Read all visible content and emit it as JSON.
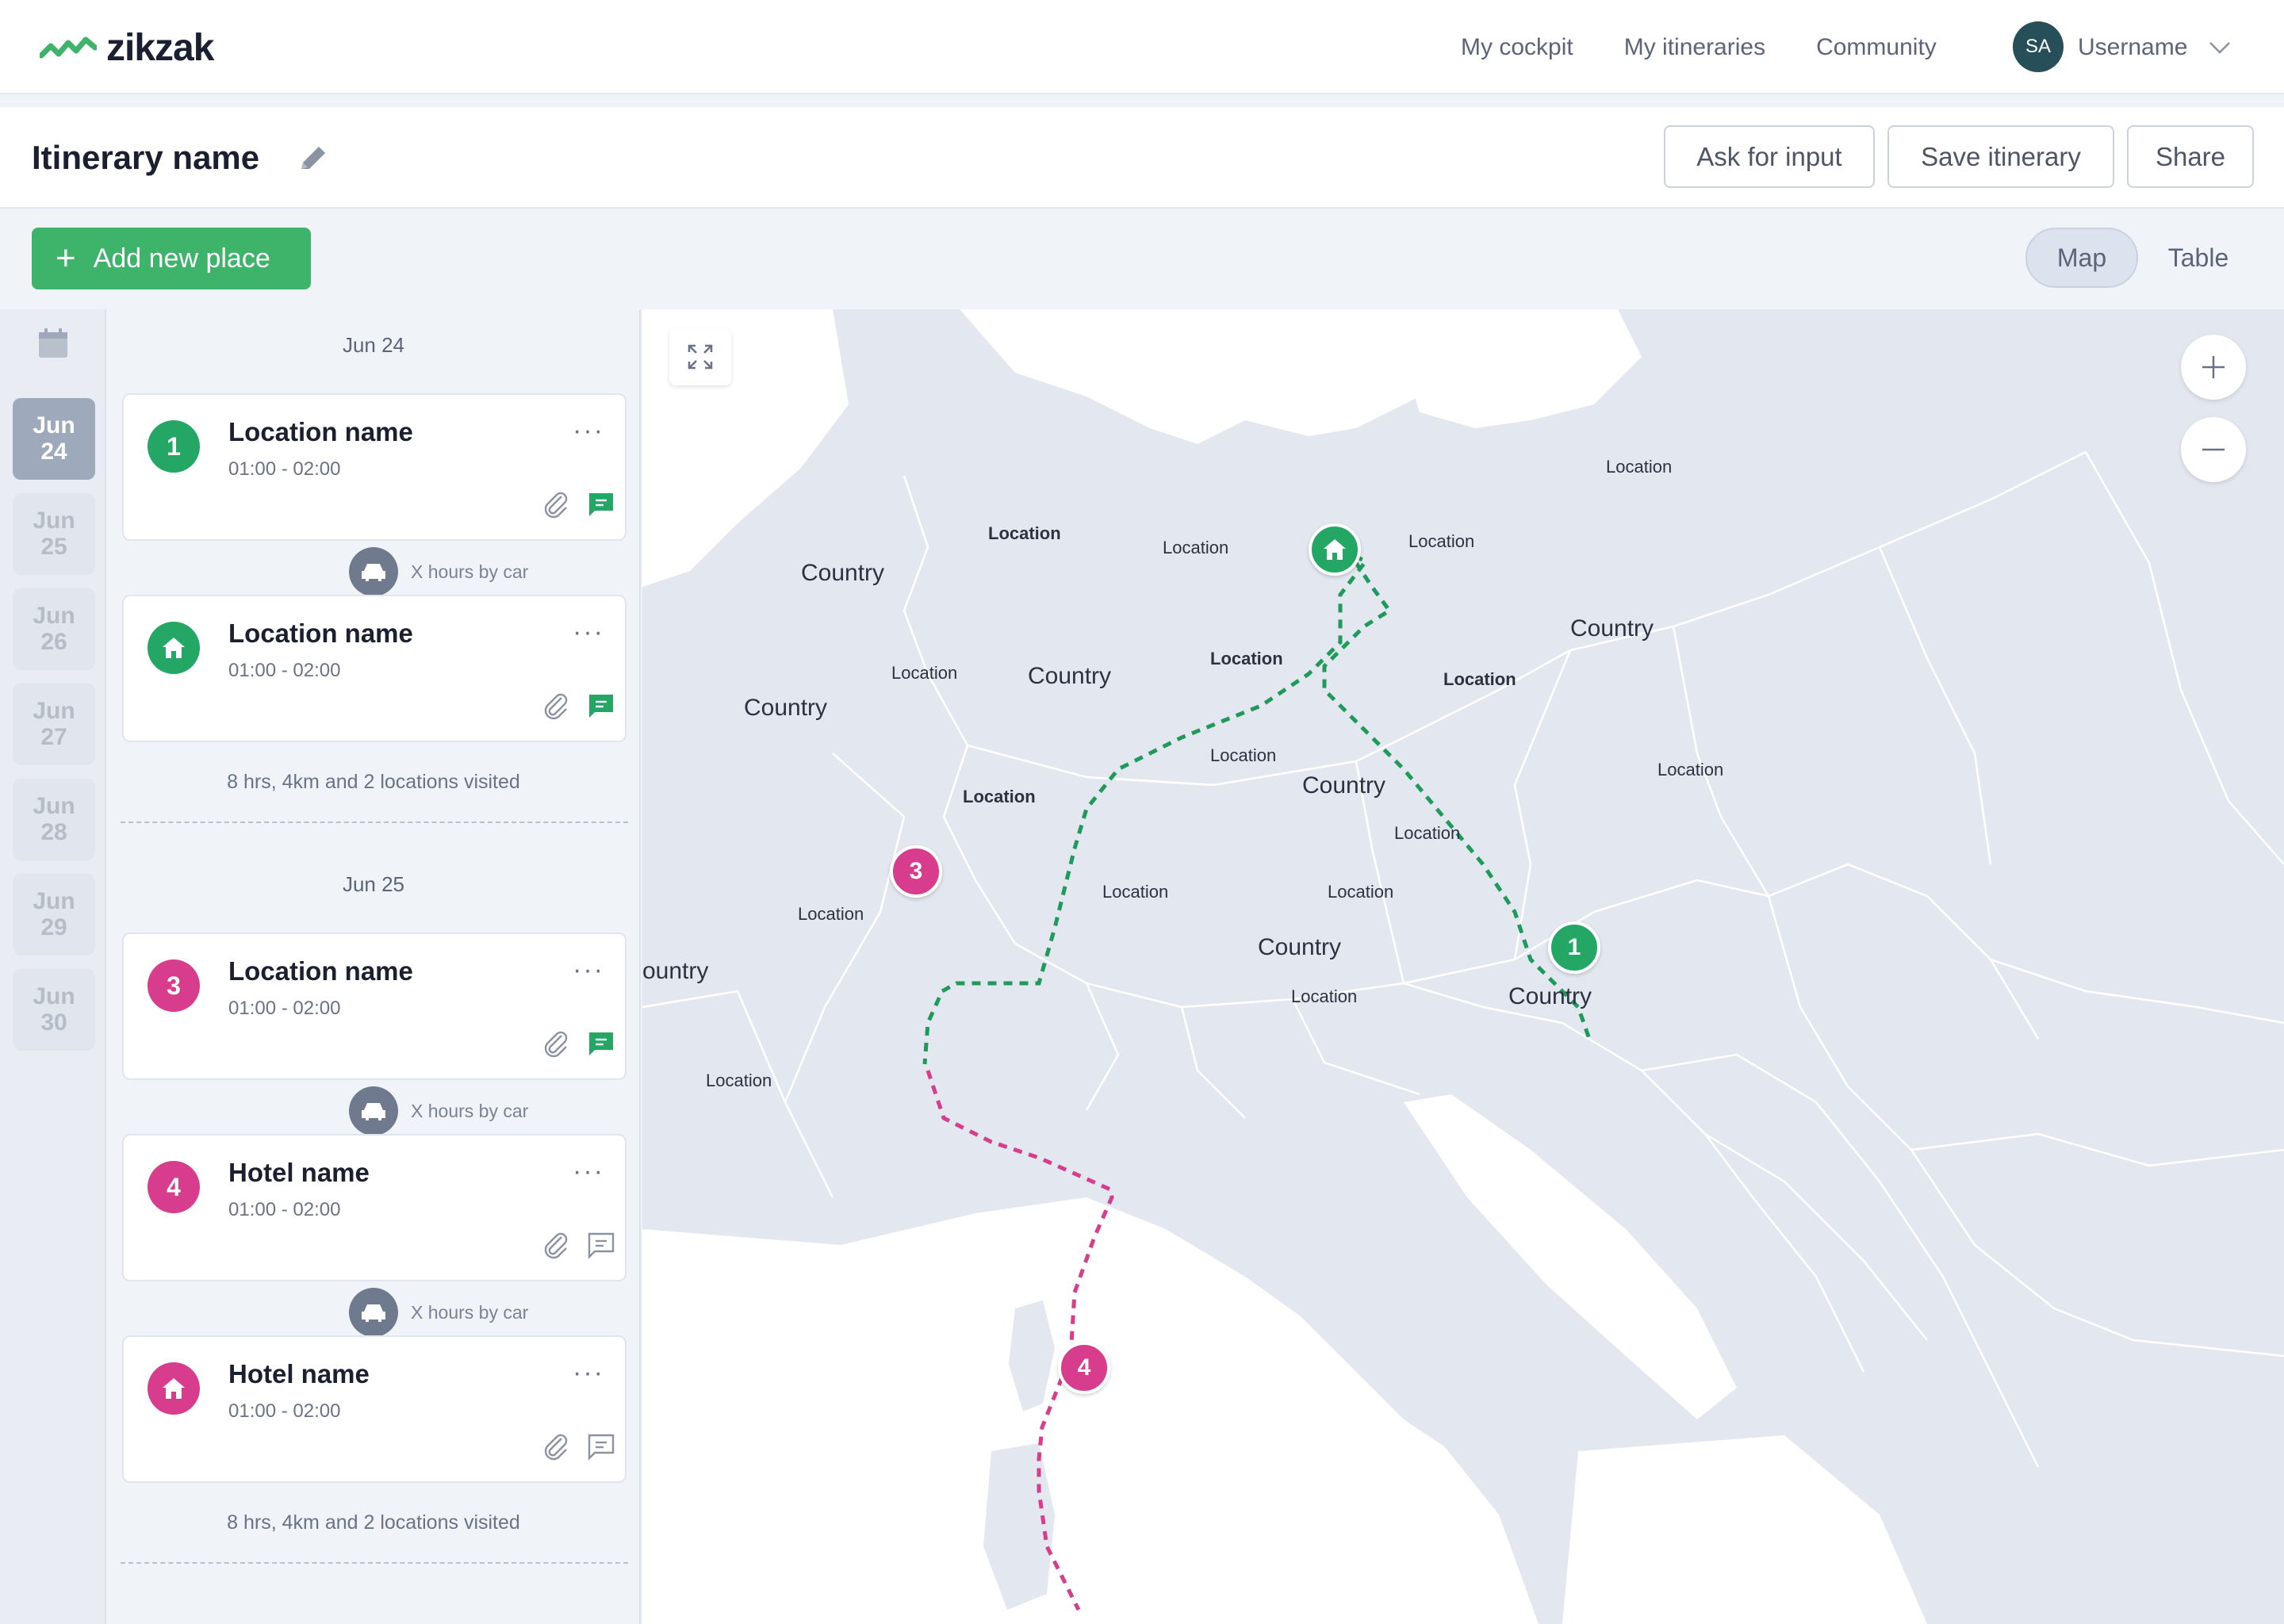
{
  "app": {
    "brand": "zikzak"
  },
  "nav": {
    "links": [
      "My cockpit",
      "My itineraries",
      "Community"
    ],
    "user_initials": "SA",
    "username": "Username"
  },
  "itinerary": {
    "name": "Itinerary name",
    "actions": {
      "ask": "Ask for input",
      "save": "Save itinerary",
      "share": "Share"
    }
  },
  "toolbar": {
    "add_place": "Add new place",
    "view_map": "Map",
    "view_table": "Table",
    "active_view": "Map"
  },
  "dates": [
    {
      "month": "Jun",
      "day": "24",
      "active": true
    },
    {
      "month": "Jun",
      "day": "25",
      "active": false
    },
    {
      "month": "Jun",
      "day": "26",
      "active": false
    },
    {
      "month": "Jun",
      "day": "27",
      "active": false
    },
    {
      "month": "Jun",
      "day": "28",
      "active": false
    },
    {
      "month": "Jun",
      "day": "29",
      "active": false
    },
    {
      "month": "Jun",
      "day": "30",
      "active": false
    }
  ],
  "days": [
    {
      "header": "Jun 24",
      "summary": "8 hrs, 4km and 2 locations visited",
      "places": [
        {
          "badge": "1",
          "badge_type": "number",
          "color": "green",
          "name": "Location name",
          "time": "01:00 - 02:00",
          "has_note": true
        },
        {
          "badge": "home",
          "badge_type": "icon",
          "color": "green",
          "name": "Location name",
          "time": "01:00 - 02:00",
          "has_note": true
        }
      ],
      "travels": [
        "X hours by car"
      ]
    },
    {
      "header": "Jun 25",
      "summary": "8 hrs, 4km and 2 locations visited",
      "places": [
        {
          "badge": "3",
          "badge_type": "number",
          "color": "pink",
          "name": "Location name",
          "time": "01:00 - 02:00",
          "has_note": true
        },
        {
          "badge": "4",
          "badge_type": "number",
          "color": "pink",
          "name": "Hotel name",
          "time": "01:00 - 02:00",
          "has_note": false
        },
        {
          "badge": "home",
          "badge_type": "icon",
          "color": "pink",
          "name": "Hotel name",
          "time": "01:00 - 02:00",
          "has_note": false
        }
      ],
      "travels": [
        "X hours by car",
        "X hours by car"
      ]
    }
  ],
  "map": {
    "labels": [
      {
        "text": "Location",
        "bold": false,
        "kind": "location"
      },
      {
        "text": "Location",
        "bold": true,
        "kind": "location"
      },
      {
        "text": "Location",
        "bold": false,
        "kind": "location"
      },
      {
        "text": "Location",
        "bold": false,
        "kind": "location"
      },
      {
        "text": "Country",
        "bold": false,
        "kind": "country"
      },
      {
        "text": "Country",
        "bold": false,
        "kind": "country"
      },
      {
        "text": "Location",
        "bold": false,
        "kind": "location"
      },
      {
        "text": "Country",
        "bold": false,
        "kind": "country"
      },
      {
        "text": "Location",
        "bold": true,
        "kind": "location"
      },
      {
        "text": "Location",
        "bold": true,
        "kind": "location"
      },
      {
        "text": "Country",
        "bold": false,
        "kind": "country"
      },
      {
        "text": "Location",
        "bold": false,
        "kind": "location"
      },
      {
        "text": "Country",
        "bold": false,
        "kind": "country"
      },
      {
        "text": "Location",
        "bold": false,
        "kind": "location"
      },
      {
        "text": "Location",
        "bold": true,
        "kind": "location"
      },
      {
        "text": "Location",
        "bold": false,
        "kind": "location"
      },
      {
        "text": "Location",
        "bold": false,
        "kind": "location"
      },
      {
        "text": "Location",
        "bold": false,
        "kind": "location"
      },
      {
        "text": "Location",
        "bold": false,
        "kind": "location"
      },
      {
        "text": "ountry",
        "bold": false,
        "kind": "country"
      },
      {
        "text": "Country",
        "bold": false,
        "kind": "country"
      },
      {
        "text": "Location",
        "bold": false,
        "kind": "location"
      },
      {
        "text": "Country",
        "bold": false,
        "kind": "country"
      },
      {
        "text": "Location",
        "bold": false,
        "kind": "location"
      }
    ],
    "pins": [
      {
        "label": "home",
        "color": "green"
      },
      {
        "label": "1",
        "color": "green"
      },
      {
        "label": "3",
        "color": "pink"
      },
      {
        "label": "4",
        "color": "pink"
      }
    ]
  },
  "colors": {
    "accent_green": "#3eb46a",
    "pin_green": "#24a765",
    "pin_pink": "#d73d8c",
    "route_green": "#1f9a5b",
    "route_pink": "#d73d8c",
    "avatar_bg": "#264f5a"
  },
  "icons": {
    "logo": "zigzag-logo-icon",
    "edit": "pencil-icon",
    "user_menu": "chevron-down-icon",
    "add": "plus-icon",
    "calendar": "calendar-icon",
    "card_more": "more-horizontal-icon",
    "attachment": "paperclip-icon",
    "note": "message-icon",
    "travel": "car-icon",
    "home": "home-icon",
    "map_expand": "expand-icon",
    "zoom_in": "zoom-in-icon",
    "zoom_out": "zoom-out-icon"
  }
}
